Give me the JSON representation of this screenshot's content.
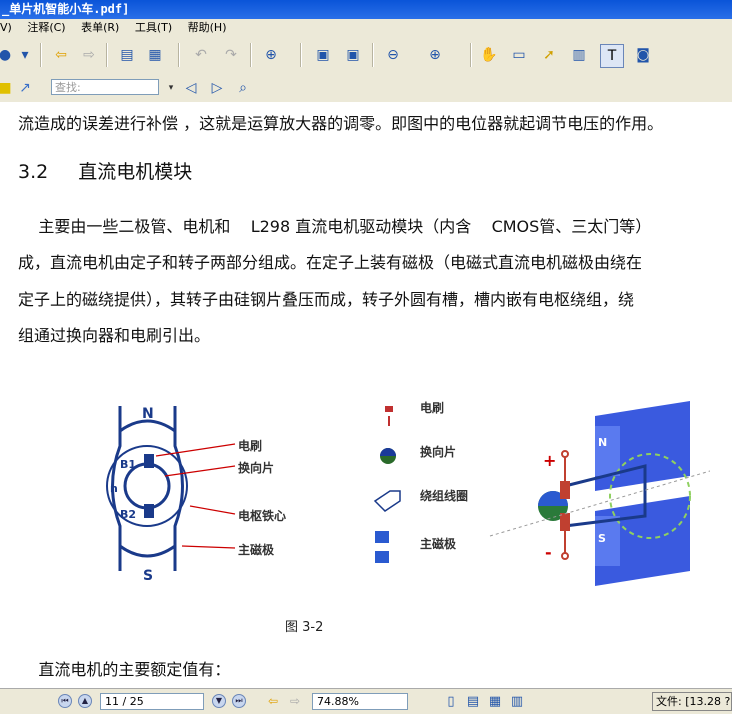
{
  "window": {
    "title": "_单片机智能小车.pdf]"
  },
  "menu": {
    "items": [
      "V)",
      "注释(C)",
      "表单(R)",
      "工具(T)",
      "帮助(H)"
    ]
  },
  "toolbar": {
    "search_placeholder": "查找:"
  },
  "document": {
    "line1": "流造成的误差进行补偿 ，这就是运算放大器的调零。即图中的电位器就起调节电压的作用。",
    "heading_number": "3.2",
    "heading_text": "直流电机模块",
    "body_lines": [
      "    主要由一些二极管、电机和    L298 直流电机驱动模块（内含    CMOS管、三太门等）",
      "成，直流电机由定子和转子两部分组成。在定子上装有磁极（电磁式直流电机磁极由绕在",
      "定子上的磁绕提供），其转子由硅钢片叠压而成，转子外圆有槽，槽内嵌有电枢绕组，绕",
      "组通过换向器和电刷引出。"
    ],
    "figure": {
      "caption": "图  3-2",
      "labels": {
        "north": "N",
        "south": "S",
        "b1": "B1",
        "b2": "B2",
        "n": "n",
        "brush": "电刷",
        "commutator": "换向片",
        "armature_core": "电枢铁心",
        "main_pole": "主磁极",
        "plus": "+",
        "minus": "-",
        "pole_n": "N",
        "pole_s": "S"
      },
      "legend": [
        "电刷",
        "换向片",
        "绕组线圈",
        "主磁极"
      ]
    },
    "last_line": "    直流电机的主要额定值有："
  },
  "status": {
    "page": "11 / 25",
    "zoom": "74.88%",
    "file": "文件: [13.28 ?"
  }
}
